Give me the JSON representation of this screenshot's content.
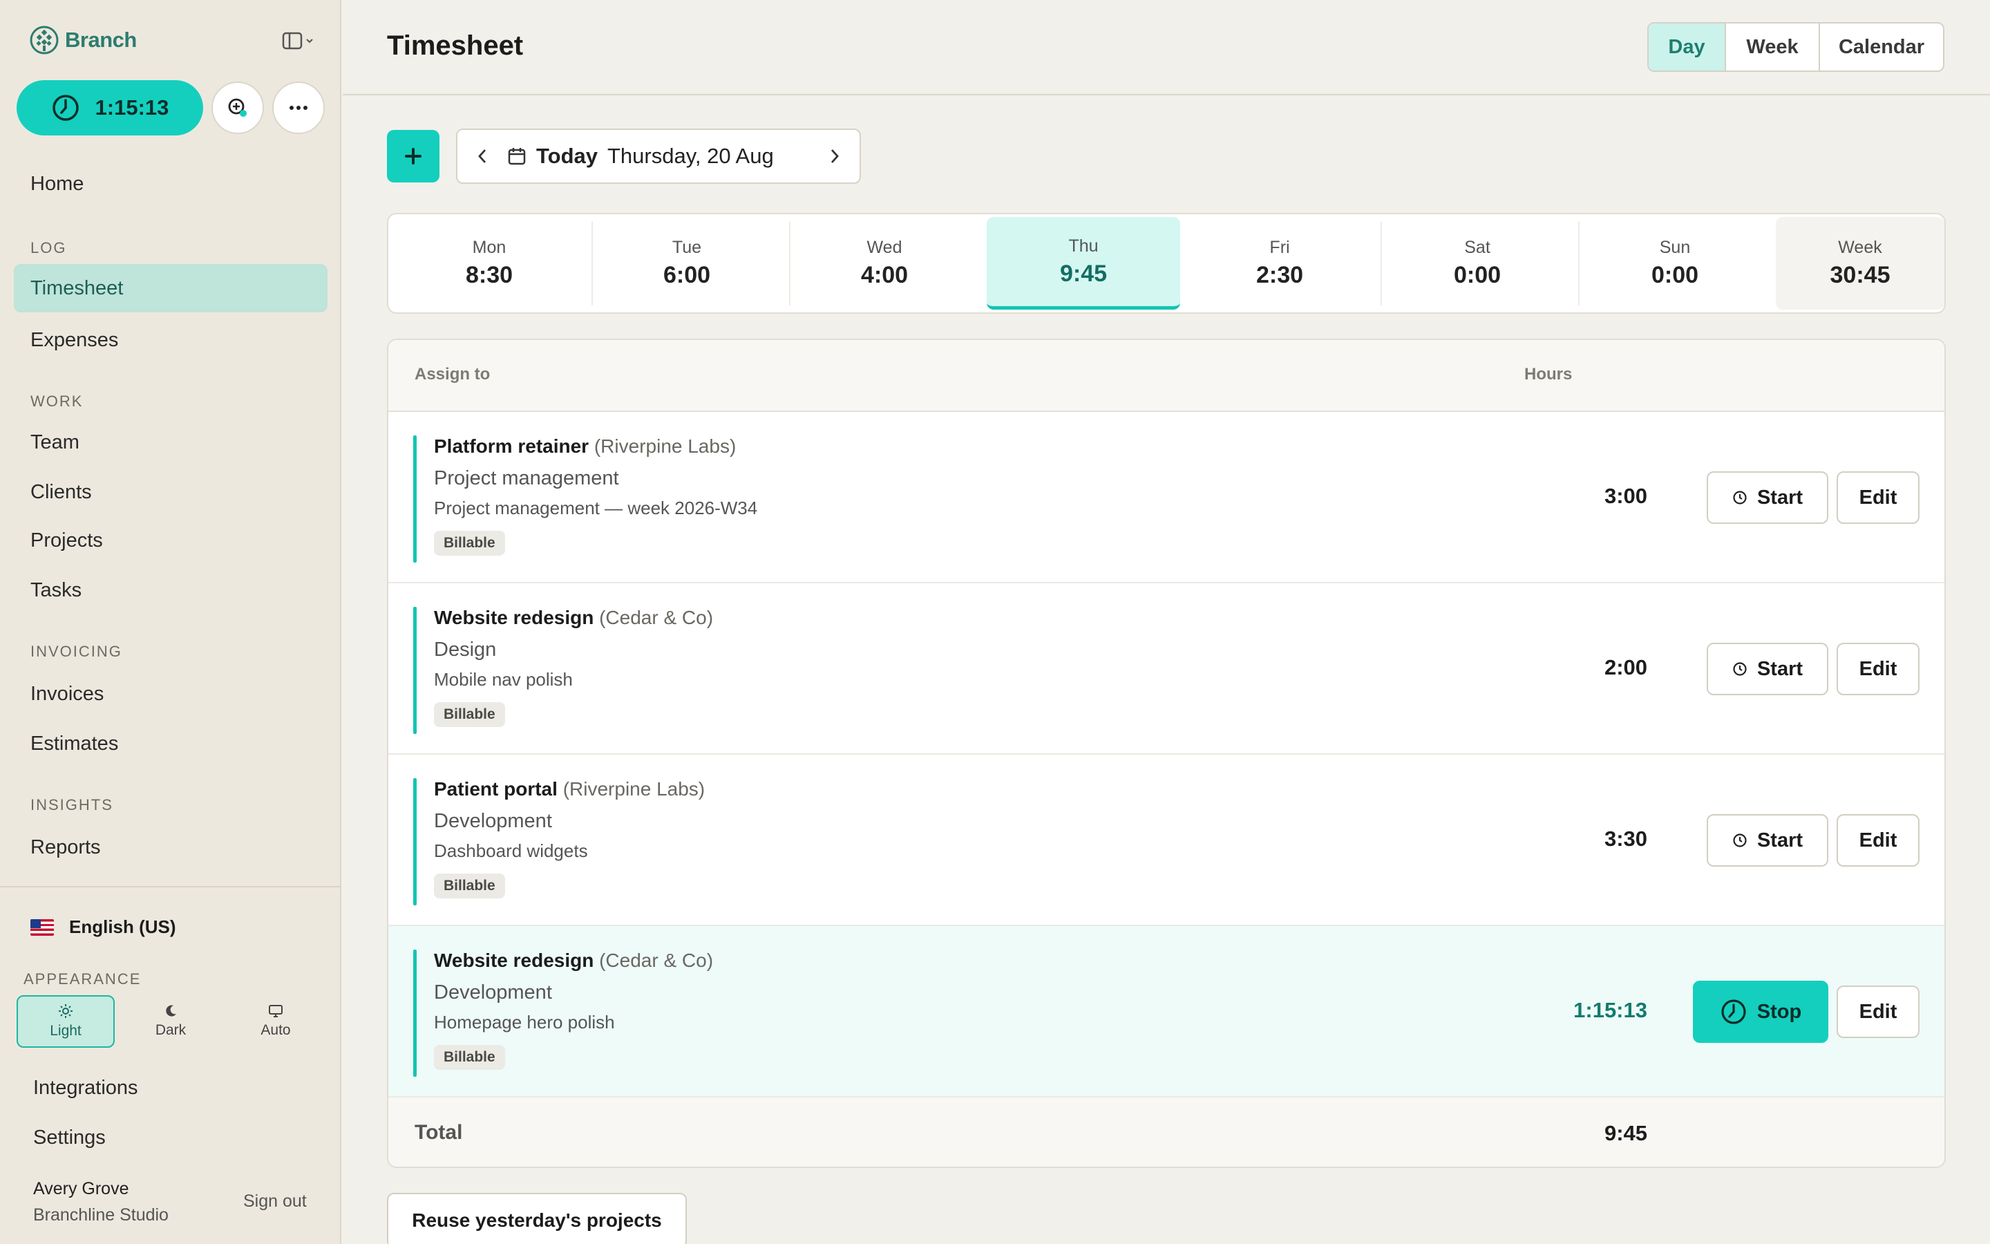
{
  "brand": {
    "name": "Branch"
  },
  "timer": {
    "elapsed": "1:15:13"
  },
  "nav": {
    "home": "Home",
    "sections": {
      "log": "LOG",
      "work": "WORK",
      "invoicing": "INVOICING",
      "insights": "INSIGHTS"
    },
    "timesheet": "Timesheet",
    "expenses": "Expenses",
    "team": "Team",
    "clients": "Clients",
    "projects": "Projects",
    "tasks": "Tasks",
    "invoices": "Invoices",
    "estimates": "Estimates",
    "reports": "Reports",
    "integrations": "Integrations",
    "settings": "Settings"
  },
  "language": {
    "label": "English (US)"
  },
  "appearance": {
    "label": "APPEARANCE",
    "options": [
      {
        "label": "Light",
        "selected": true
      },
      {
        "label": "Dark",
        "selected": false
      },
      {
        "label": "Auto",
        "selected": false
      }
    ]
  },
  "user": {
    "name": "Avery Grove",
    "org": "Branchline Studio",
    "signout": "Sign out"
  },
  "header": {
    "title": "Timesheet",
    "views": [
      {
        "label": "Day",
        "active": true
      },
      {
        "label": "Week",
        "active": false
      },
      {
        "label": "Calendar",
        "active": false
      }
    ]
  },
  "date_nav": {
    "today_label": "Today",
    "date": "Thursday, 20 Aug"
  },
  "days": [
    {
      "name": "Mon",
      "hours": "8:30"
    },
    {
      "name": "Tue",
      "hours": "6:00"
    },
    {
      "name": "Wed",
      "hours": "4:00"
    },
    {
      "name": "Thu",
      "hours": "9:45",
      "selected": true
    },
    {
      "name": "Fri",
      "hours": "2:30"
    },
    {
      "name": "Sat",
      "hours": "0:00"
    },
    {
      "name": "Sun",
      "hours": "0:00"
    }
  ],
  "week_total": {
    "name": "Week",
    "hours": "30:45"
  },
  "table": {
    "col_assign": "Assign to",
    "col_hours": "Hours",
    "entries": [
      {
        "project": "Platform retainer",
        "client": "(Riverpine Labs)",
        "task": "Project management",
        "note": "Project management — week 2026-W34",
        "badge": "Billable",
        "hours": "3:00",
        "action": "Start",
        "edit": "Edit"
      },
      {
        "project": "Website redesign",
        "client": "(Cedar & Co)",
        "task": "Design",
        "note": "Mobile nav polish",
        "badge": "Billable",
        "hours": "2:00",
        "action": "Start",
        "edit": "Edit"
      },
      {
        "project": "Patient portal",
        "client": "(Riverpine Labs)",
        "task": "Development",
        "note": "Dashboard widgets",
        "badge": "Billable",
        "hours": "3:30",
        "action": "Start",
        "edit": "Edit"
      },
      {
        "project": "Website redesign",
        "client": "(Cedar & Co)",
        "task": "Development",
        "note": "Homepage hero polish",
        "badge": "Billable",
        "hours": "1:15:13",
        "action": "Stop",
        "edit": "Edit",
        "running": true
      }
    ],
    "total_label": "Total",
    "total_hours": "9:45"
  },
  "reuse_button": "Reuse yesterday's projects",
  "colors": {
    "accent": "#14cfbd",
    "accent_dark": "#127c6d",
    "sidebar_bg": "#ede8de",
    "active_nav": "#bfe4d9"
  }
}
